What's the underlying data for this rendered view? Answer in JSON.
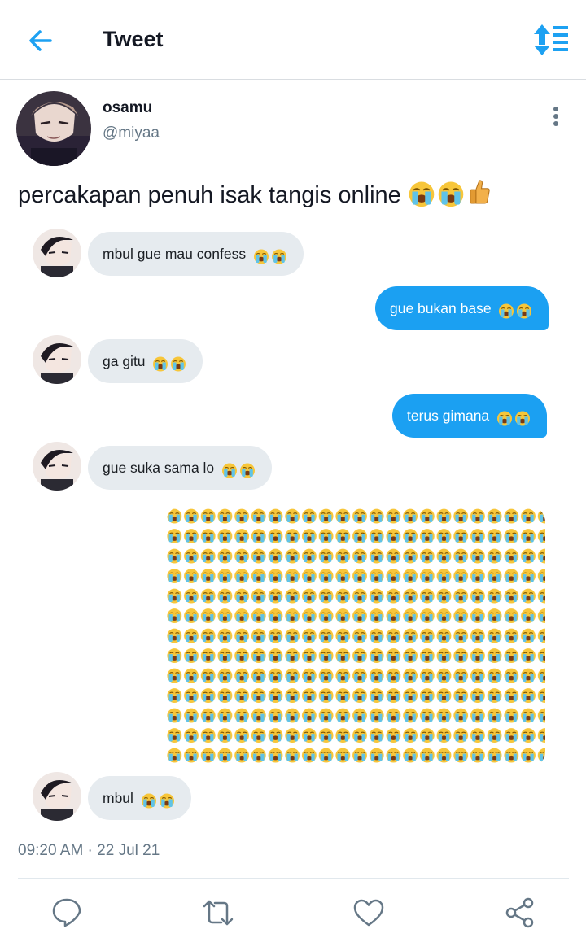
{
  "header": {
    "title": "Tweet",
    "back_icon": "back-arrow-icon",
    "sort_icon": "sort-icon",
    "accent": "#1da1f2"
  },
  "author": {
    "name": "osamu",
    "handle": "@miyaa"
  },
  "tweet": {
    "text": "percakapan penuh isak tangis online ",
    "emoji": [
      "loudly-crying-face",
      "loudly-crying-face",
      "thumbs-up"
    ]
  },
  "chat": {
    "messages": [
      {
        "side": "in",
        "text": "mbul gue mau confess "
      },
      {
        "side": "out",
        "text": "gue bukan base "
      },
      {
        "side": "in",
        "text": "ga gitu "
      },
      {
        "side": "out",
        "text": "terus gimana "
      },
      {
        "side": "in",
        "text": "gue suka sama lo "
      },
      {
        "side": "out",
        "text": "",
        "emoji_grid": {
          "rows": 13,
          "cols": 22,
          "emoji": "loudly-crying-face"
        }
      },
      {
        "side": "in",
        "text": "mbul "
      }
    ],
    "bubble_in_color": "#e6ebef",
    "bubble_out_color": "#1ba0f2"
  },
  "timestamp": "09:20 AM · 22 Jul 21",
  "actions": [
    "reply-icon",
    "retweet-icon",
    "like-icon",
    "share-icon"
  ]
}
